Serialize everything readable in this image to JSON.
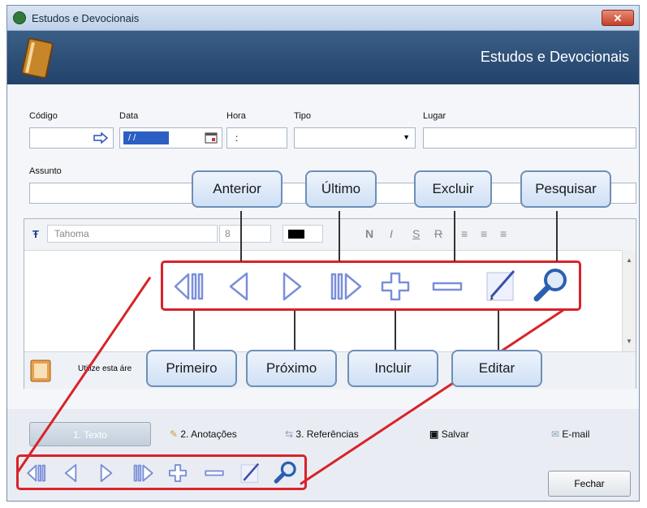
{
  "window": {
    "title": "Estudos e Devocionais",
    "close_label": "✕"
  },
  "banner": {
    "title": "Estudos e Devocionais"
  },
  "form": {
    "codigo_label": "Código",
    "data_label": "Data",
    "data_value": "/ /",
    "hora_label": "Hora",
    "hora_value": ":",
    "tipo_label": "Tipo",
    "lugar_label": "Lugar",
    "assunto_label": "Assunto"
  },
  "editor": {
    "font": "Tahoma",
    "size": "8",
    "format": {
      "bold": "N",
      "italic": "I",
      "underline": "S",
      "strike": "R"
    },
    "info": "Utilize esta áre"
  },
  "tabs": [
    {
      "label": "1. Texto"
    },
    {
      "label": "2. Anotações"
    },
    {
      "label": "3. Referências"
    },
    {
      "label": "Salvar"
    },
    {
      "label": "E-mail"
    }
  ],
  "buttons": {
    "fechar": "Fechar"
  },
  "callouts": {
    "anterior": "Anterior",
    "ultimo": "Último",
    "excluir": "Excluir",
    "pesquisar": "Pesquisar",
    "primeiro": "Primeiro",
    "proximo": "Próximo",
    "incluir": "Incluir",
    "editar": "Editar"
  },
  "colors": {
    "accent": "#d8232a",
    "banner": "#2d4f79",
    "icon": "#7a8fd9"
  }
}
